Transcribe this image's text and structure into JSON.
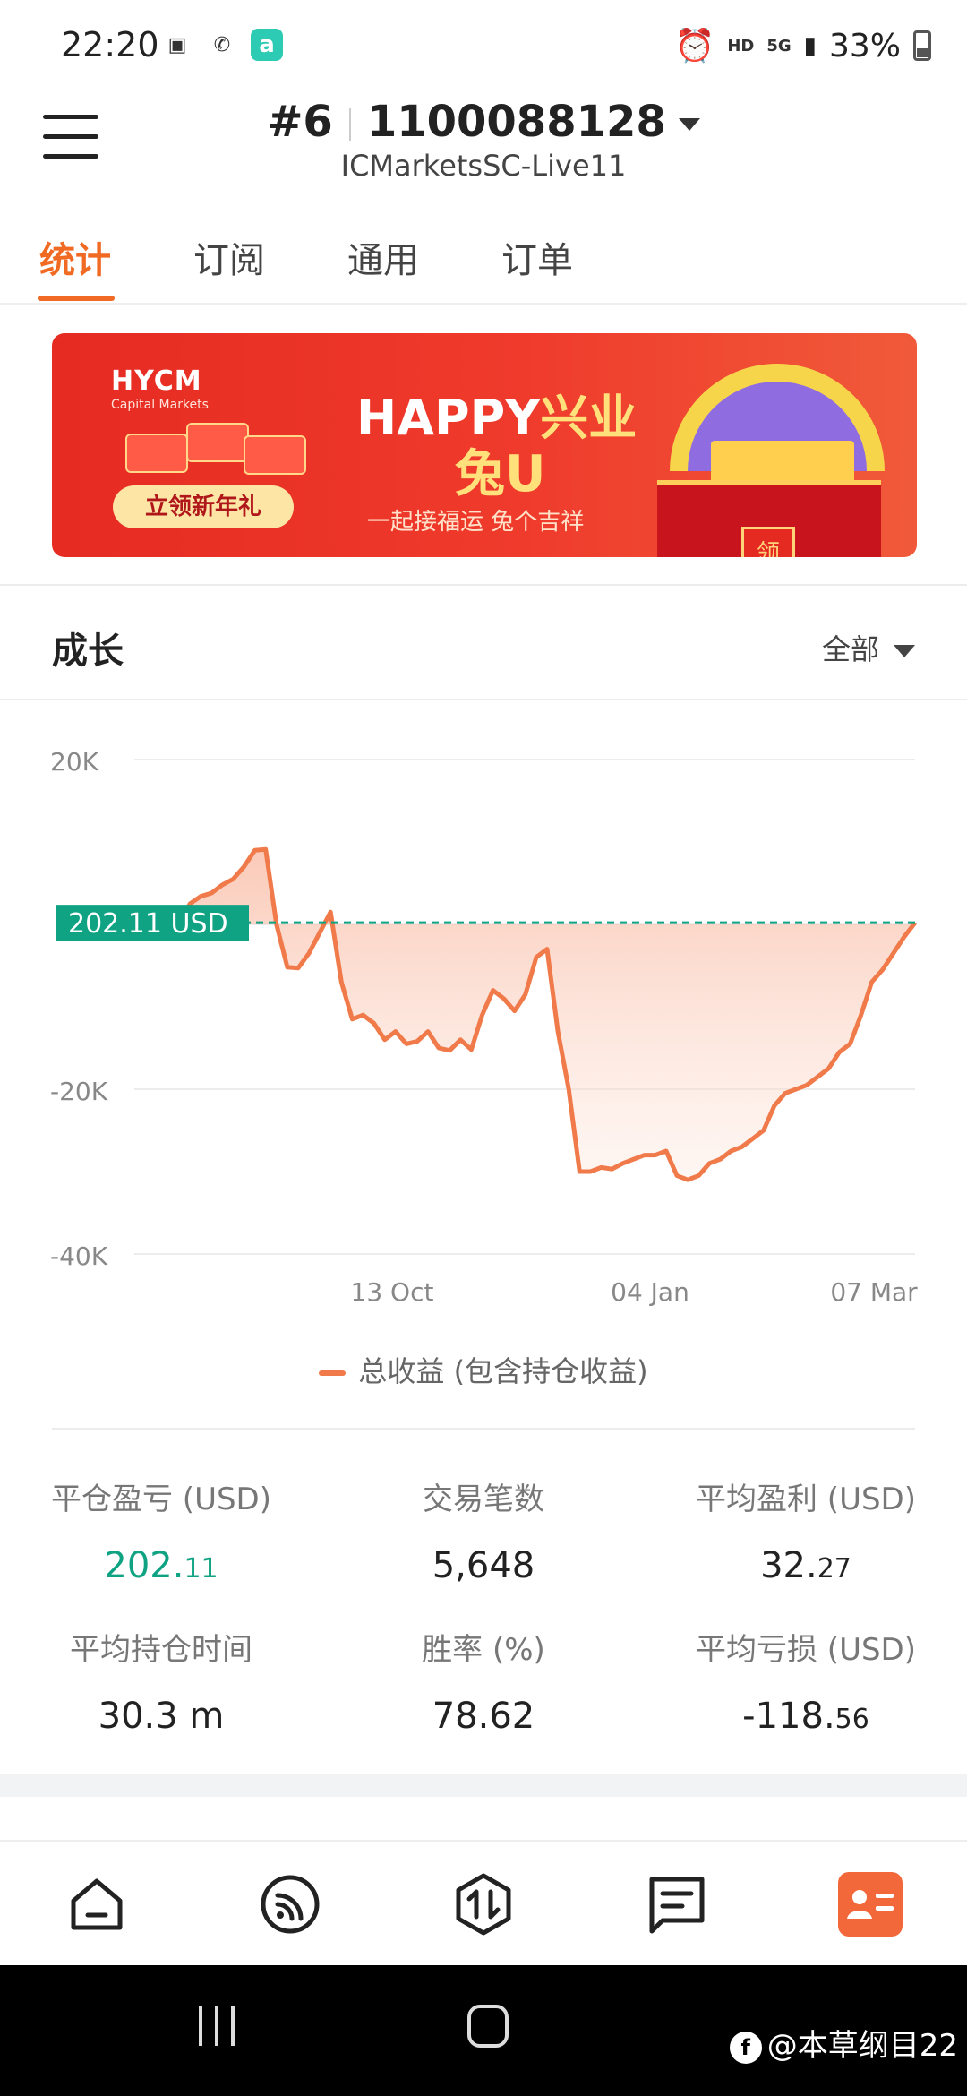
{
  "status_bar": {
    "time": "22:20",
    "hd": "HD",
    "network": "5G",
    "battery": "33%"
  },
  "header": {
    "account_index": "#6",
    "account_number": "1100088128",
    "server": "ICMarketsSC-Live11"
  },
  "tabs": [
    {
      "label": "统计",
      "active": true
    },
    {
      "label": "订阅",
      "active": false
    },
    {
      "label": "通用",
      "active": false
    },
    {
      "label": "订单",
      "active": false
    }
  ],
  "banner": {
    "brand": "HYCM",
    "brand_sub": "Capital Markets",
    "title_prefix": "HAPPY",
    "title_cn": "兴业",
    "title_line2": "兔U",
    "subtitle": "一起接福运 兔个吉祥",
    "cta": "立领新年礼",
    "box_tag": "领"
  },
  "growth": {
    "title": "成长",
    "range": "全部",
    "current_label": "202.11 USD",
    "legend": "总收益 (包含持仓收益)"
  },
  "chart_data": {
    "type": "area",
    "y_ticks": [
      "20K",
      "-20K",
      "-40K"
    ],
    "x_ticks": [
      "13 Oct",
      "04 Jan",
      "07 Mar"
    ],
    "ylim": [
      -40000,
      20000
    ],
    "current_value": 202.11,
    "series": [
      {
        "values": [
          0,
          2500,
          3400,
          3800,
          4800,
          5500,
          7000,
          9000,
          9100,
          0,
          -5200,
          -5300,
          -3500,
          -1000,
          1500,
          -7000,
          -11500,
          -11000,
          -12000,
          -14000,
          -13000,
          -14500,
          -14200,
          -13000,
          -15000,
          -15300,
          -14000,
          -15200,
          -11000,
          -8000,
          -9000,
          -10500,
          -8500,
          -4000,
          -3000,
          -13000,
          -20000,
          -30000,
          -30000,
          -29500,
          -29700,
          -29000,
          -28500,
          -28000,
          -28000,
          -27500,
          -30500,
          -31000,
          -30500,
          -29000,
          -28500,
          -27500,
          -27000,
          -26000,
          -25000,
          -22000,
          -20500,
          -20000,
          -19500,
          -18500,
          -17500,
          -15500,
          -14500,
          -11000,
          -7000,
          -5500,
          -3500,
          -1500,
          202.11
        ]
      }
    ]
  },
  "stats": [
    {
      "label": "平仓盈亏 (USD)",
      "value_main": "202.",
      "value_dec": "11",
      "color": "#10a383"
    },
    {
      "label": "交易笔数",
      "value_main": "5,648",
      "value_dec": ""
    },
    {
      "label": "平均盈利 (USD)",
      "value_main": "32.",
      "value_dec": "27"
    },
    {
      "label": "平均持仓时间",
      "value_main": "30.3 m",
      "value_dec": ""
    },
    {
      "label": "胜率 (%)",
      "value_main": "78.62",
      "value_dec": ""
    },
    {
      "label": "平均亏损 (USD)",
      "value_main": "-118.",
      "value_dec": "56"
    }
  ],
  "bottom_nav": [
    {
      "icon": "home-icon",
      "active": false
    },
    {
      "icon": "signal-icon",
      "active": false
    },
    {
      "icon": "trade-icon",
      "active": false
    },
    {
      "icon": "news-icon",
      "active": false
    },
    {
      "icon": "profile-card-icon",
      "active": true
    }
  ],
  "watermark": "@本草纲目22",
  "colors": {
    "accent": "#f06a23",
    "line": "#f07a4a",
    "green": "#10a383"
  }
}
